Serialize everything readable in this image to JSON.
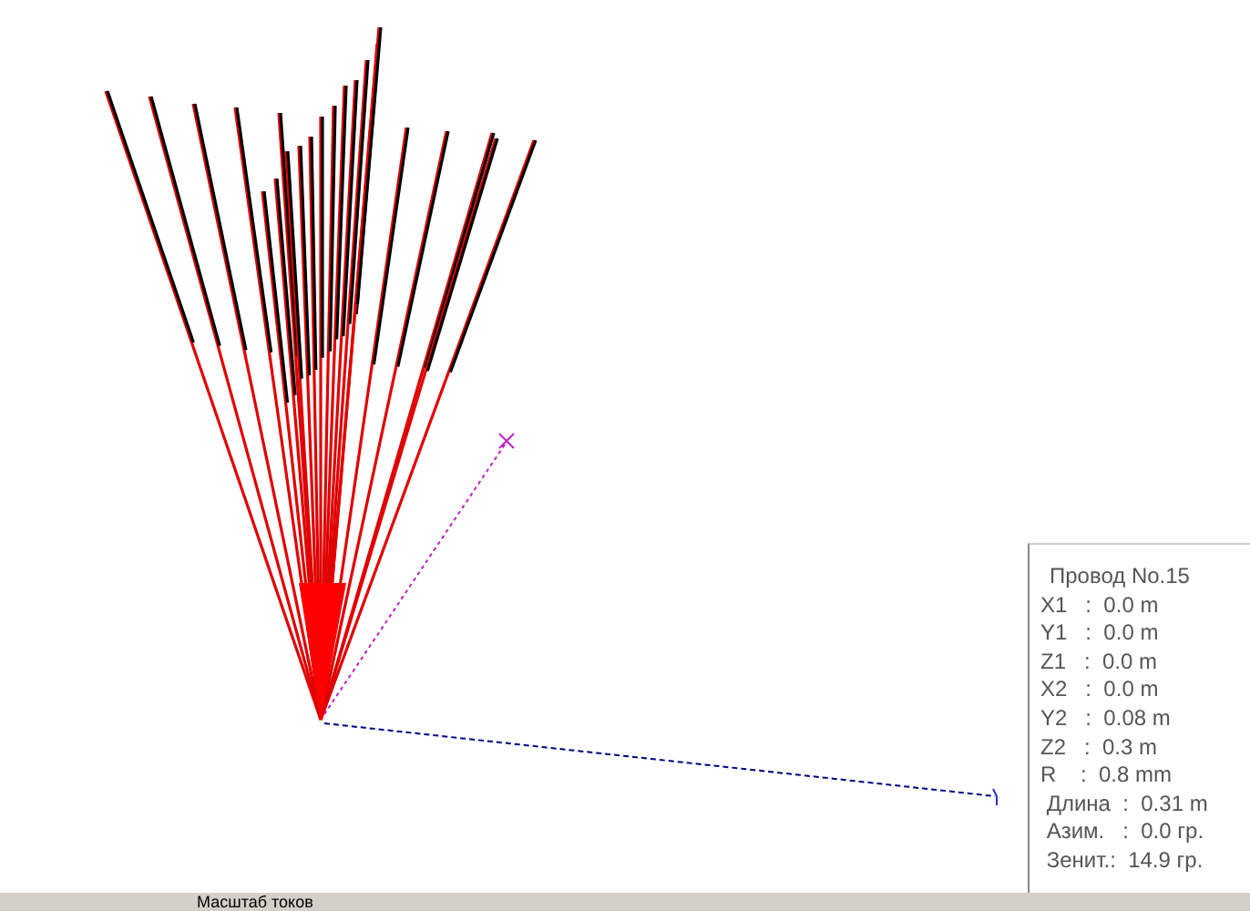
{
  "info_panel": {
    "title": "Провод No.15",
    "lines": [
      "X1   :  0.0 m",
      "Y1   :  0.0 m",
      "Z1   :  0.0 m",
      "X2   :  0.0 m",
      "Y2   :  0.08 m",
      "Z2   :  0.3 m",
      "R    :  0.8 mm",
      " Длина  :  0.31 m",
      " Азим.   :  0.0 гр.",
      " Зенит.:  14.9 гр."
    ]
  },
  "status_bar": {
    "label": "Масштаб токов"
  }
}
